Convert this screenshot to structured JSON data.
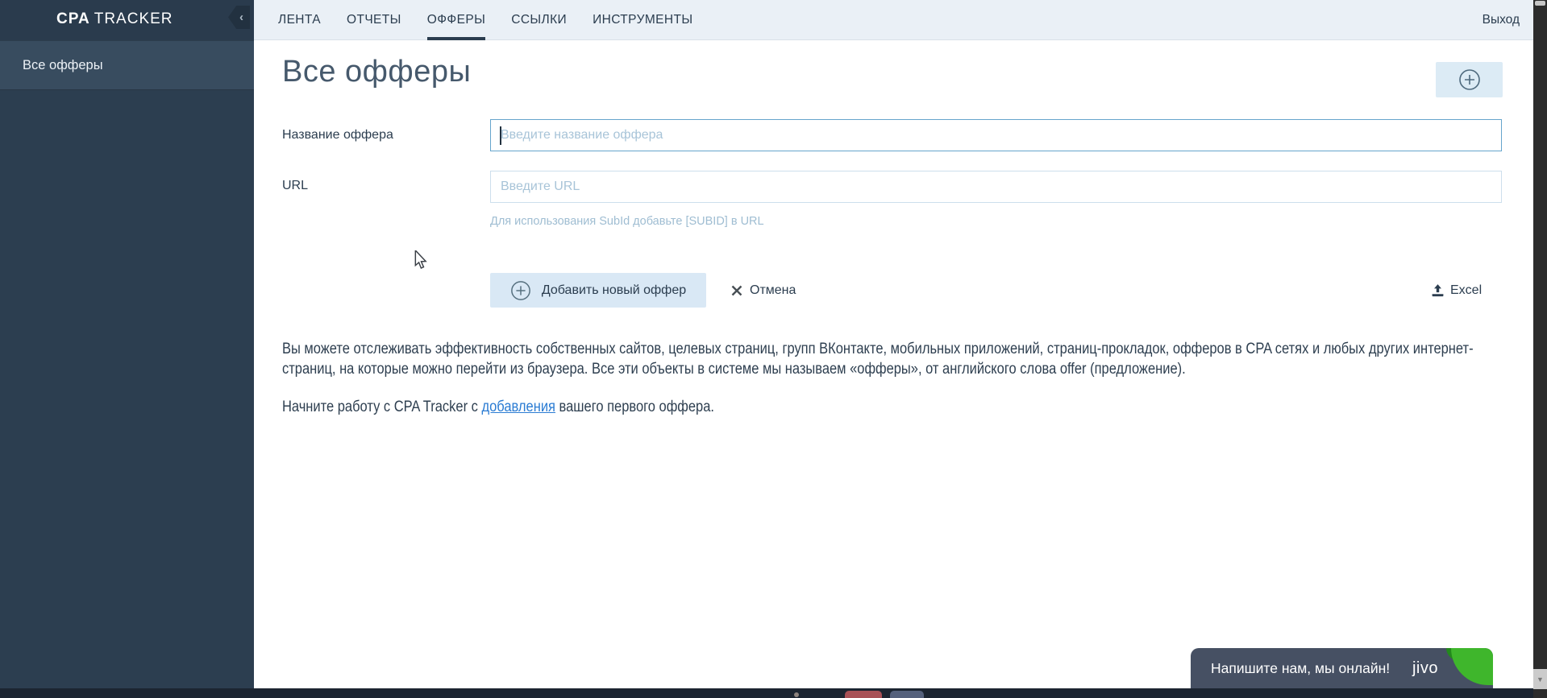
{
  "app": {
    "brand_bold": "CPA",
    "brand_rest": "TRACKER"
  },
  "nav": {
    "tabs": [
      {
        "label": "ЛЕНТА",
        "active": false
      },
      {
        "label": "ОТЧЕТЫ",
        "active": false
      },
      {
        "label": "ОФФЕРЫ",
        "active": true
      },
      {
        "label": "ССЫЛКИ",
        "active": false
      },
      {
        "label": "ИНСТРУМЕНТЫ",
        "active": false
      }
    ],
    "logout_label": "Выход",
    "collapse_icon": "‹"
  },
  "sidebar": {
    "items": [
      {
        "label": "Все офферы",
        "active": true
      }
    ]
  },
  "page": {
    "title": "Все офферы"
  },
  "form": {
    "name_label": "Название оффера",
    "name_placeholder": "Введите название оффера",
    "url_label": "URL",
    "url_placeholder": "Введите URL",
    "url_hint": "Для использования SubId добавьте [SUBID] в URL",
    "submit_label": "Добавить новый оффер",
    "cancel_label": "Отмена",
    "excel_label": "Excel"
  },
  "content": {
    "intro_paragraph": "Вы можете отслеживать эффективность собственных сайтов, целевых страниц, групп ВКонтакте, мобильных приложений, страниц-прокладок, офферов в CPA сетях и любых других интернет-страниц, на которые можно перейти из браузера. Все эти объекты в системе мы называем «офферы», от английского слова offer (предложение).",
    "start_text_before": "Начните работу с CPA Tracker с ",
    "start_link": "добавления",
    "start_text_after": " вашего первого оффера."
  },
  "chat": {
    "message": "Напишите нам, мы онлайн!",
    "brand": "jivo"
  },
  "scrollbar": {
    "down_arrow": "▼"
  },
  "colors": {
    "sidebar": "#2c3e50",
    "sidebar_selected": "#384c5f",
    "navbar_bg": "#eaf0f6",
    "accent_text": "#2b3d4f",
    "focus_border": "#66a5cc",
    "button_bg": "#d9e8f5",
    "link": "#2b7cd3",
    "jivo_bg": "#465063",
    "jivo_green": "#3fb62c"
  }
}
